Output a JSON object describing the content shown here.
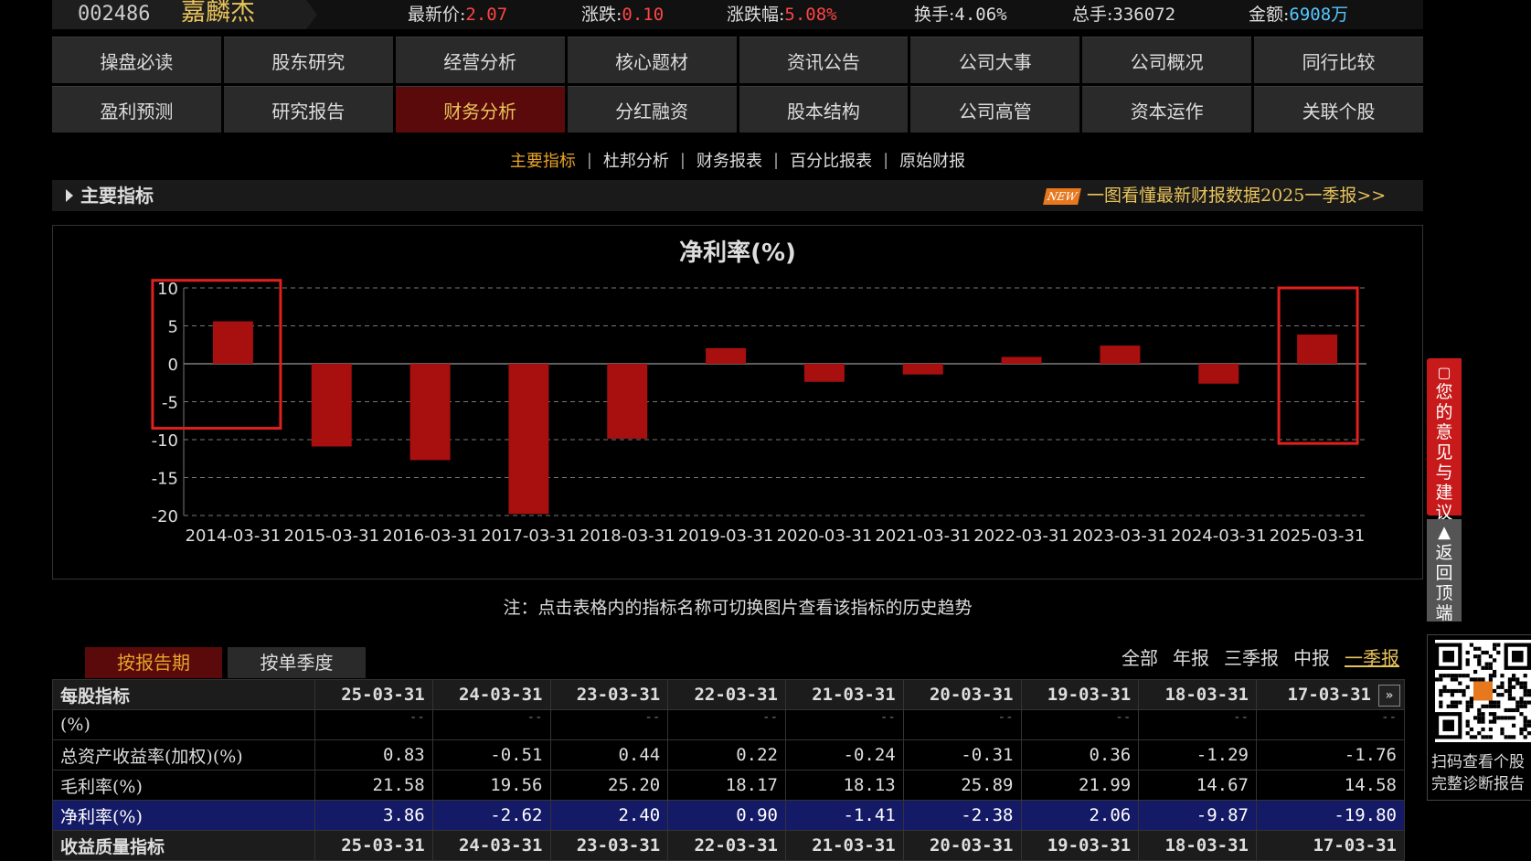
{
  "quote": {
    "code": "002486",
    "name": "嘉麟杰",
    "price_label": "最新价:",
    "price": "2.07",
    "change_label": "涨跌:",
    "change": "0.10",
    "pct_label": "涨跌幅:",
    "pct": "5.08%",
    "turnover_label": "换手:",
    "turnover": "4.06%",
    "volume_label": "总手:",
    "volume": "336072",
    "amount_label": "金额:",
    "amount": "6908万"
  },
  "nav": {
    "row1": [
      "操盘必读",
      "股东研究",
      "经营分析",
      "核心题材",
      "资讯公告",
      "公司大事",
      "公司概况",
      "同行比较"
    ],
    "row2": [
      "盈利预测",
      "研究报告",
      "财务分析",
      "分红融资",
      "股本结构",
      "公司高管",
      "资本运作",
      "关联个股"
    ],
    "active": "财务分析"
  },
  "subtabs": [
    "主要指标",
    "杜邦分析",
    "财务报表",
    "百分比报表",
    "原始财报"
  ],
  "subtab_sep": "|",
  "section": {
    "title": "主要指标",
    "badge": "NEW",
    "link": "一图看懂最新财报数据2025一季报>>"
  },
  "chart_data": {
    "type": "bar",
    "title": "净利率(%)",
    "xlabel": "",
    "ylabel": "",
    "categories": [
      "2014-03-31",
      "2015-03-31",
      "2016-03-31",
      "2017-03-31",
      "2018-03-31",
      "2019-03-31",
      "2020-03-31",
      "2021-03-31",
      "2022-03-31",
      "2023-03-31",
      "2024-03-31",
      "2025-03-31"
    ],
    "values": [
      5.6,
      -10.9,
      -12.7,
      -19.8,
      -9.87,
      2.06,
      -2.38,
      -1.41,
      0.9,
      2.4,
      -2.62,
      3.86
    ],
    "ylim": [
      -20,
      10
    ],
    "yticks": [
      10,
      5,
      0,
      -5,
      -10,
      -15,
      -20
    ],
    "grid": true,
    "bar_color": "#a80f0f",
    "highlight_color": "#e0201e"
  },
  "note": "注：点击表格内的指标名称可切换图片查看该指标的历史趋势",
  "period_tabs": [
    "按报告期",
    "按单季度"
  ],
  "filters": [
    "全部",
    "年报",
    "三季报",
    "中报",
    "一季报"
  ],
  "filters_active": "一季报",
  "table": {
    "header_label": "每股指标",
    "columns": [
      "25-03-31",
      "24-03-31",
      "23-03-31",
      "22-03-31",
      "21-03-31",
      "20-03-31",
      "19-03-31",
      "18-03-31",
      "17-03-31"
    ],
    "scroll_icon": "»",
    "rows": [
      {
        "label": "(%)",
        "values": [
          "--",
          "--",
          "--",
          "--",
          "--",
          "--",
          "--",
          "--",
          "--"
        ]
      },
      {
        "label": "总资产收益率(加权)(%)",
        "values": [
          "0.83",
          "-0.51",
          "0.44",
          "0.22",
          "-0.24",
          "-0.31",
          "0.36",
          "-1.29",
          "-1.76"
        ]
      },
      {
        "label": "毛利率(%)",
        "values": [
          "21.58",
          "19.56",
          "25.20",
          "18.17",
          "18.13",
          "25.89",
          "21.99",
          "14.67",
          "14.58"
        ]
      },
      {
        "label": "净利率(%)",
        "values": [
          "3.86",
          "-2.62",
          "2.40",
          "0.90",
          "-1.41",
          "-2.38",
          "2.06",
          "-9.87",
          "-19.80"
        ]
      }
    ],
    "footer_label": "收益质量指标",
    "footer_columns": [
      "25-03-31",
      "24-03-31",
      "23-03-31",
      "22-03-31",
      "21-03-31",
      "20-03-31",
      "19-03-31",
      "18-03-31",
      "17-03-31"
    ]
  },
  "side": {
    "feedback": "您的意见与建议",
    "backtop": "返回顶端",
    "qr_line1": "扫码查看个股",
    "qr_line2": "完整诊断报告"
  }
}
